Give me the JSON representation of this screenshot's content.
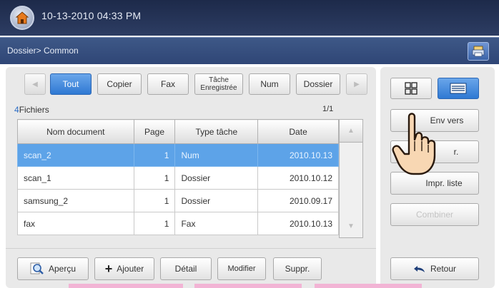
{
  "header": {
    "datetime": "10-13-2010 04:33 PM",
    "home_icon": "home-icon"
  },
  "path": {
    "text": "Dossier> Common",
    "job_icon": "job-status-icon"
  },
  "filter_tabs": [
    {
      "label": "Tout",
      "selected": true
    },
    {
      "label": "Copier",
      "selected": false
    },
    {
      "label": "Fax",
      "selected": false
    },
    {
      "label": "Tâche\nEnregistrée",
      "selected": false
    },
    {
      "label": "Num",
      "selected": false
    },
    {
      "label": "Dossier",
      "selected": false
    }
  ],
  "files": {
    "count": "4",
    "label": "Fichiers",
    "page": "1/1"
  },
  "table": {
    "headers": [
      "Nom document",
      "Page",
      "Type tâche",
      "Date"
    ],
    "rows": [
      {
        "name": "scan_2",
        "pages": "1",
        "type": "Num",
        "date": "2010.10.13",
        "selected": true
      },
      {
        "name": "scan_1",
        "pages": "1",
        "type": "Dossier",
        "date": "2010.10.12",
        "selected": false
      },
      {
        "name": "samsung_2",
        "pages": "1",
        "type": "Dossier",
        "date": "2010.09.17",
        "selected": false
      },
      {
        "name": "fax",
        "pages": "1",
        "type": "Fax",
        "date": "2010.10.13",
        "selected": false
      }
    ]
  },
  "bottom_buttons": {
    "preview": "Aperçu",
    "add": "Ajouter",
    "detail": "Détail",
    "modify": "Modifier",
    "delete": "Suppr."
  },
  "right_panel": {
    "view_grid_icon": "grid-view-icon",
    "view_list_icon": "list-view-icon",
    "send": "Env vers",
    "print_partial": "r.",
    "print_list": "Impr. liste",
    "combine": "Combiner",
    "back": "Retour"
  },
  "colors": {
    "accent": "#2f79d3",
    "selected_row": "#5da3e8",
    "topbar": "#1d2a4a"
  }
}
